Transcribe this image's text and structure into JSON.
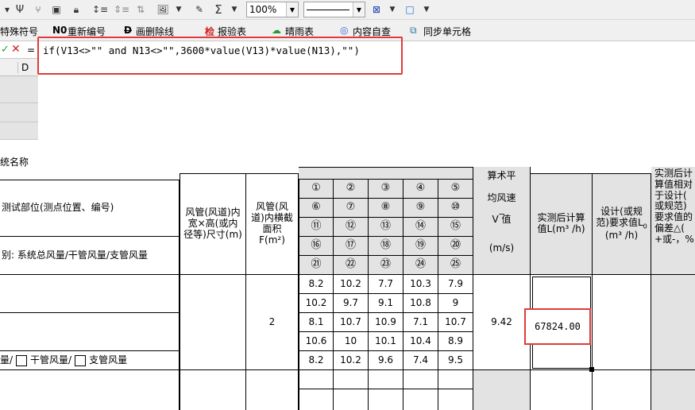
{
  "toolbar": {
    "zoom_value": "100%",
    "sigma": "Σ"
  },
  "toolbar2": {
    "special_symbol": "特殊符号",
    "renumber": "重新编号",
    "strike_line": "画删除线",
    "inspection_form": "报验表",
    "weather_form": "晴雨表",
    "content_check": "内容自查",
    "sync_cell": "同步单元格"
  },
  "formula": {
    "equals": "=",
    "text": "if(V13<>\"\" and N13<>\"\",3600*value(V13)*value(N13),\"\")"
  },
  "column_header": {
    "d": "D"
  },
  "sheet": {
    "system_name_label": "统名称",
    "measure_location": "测试部位(测点位置、编号)",
    "duct_size": "风管(风道)内宽×高(或内径等)尺寸(m)",
    "duct_area": "风管(风道)内横截面积F(m²)",
    "avg_speed_top": "算术平",
    "avg_speed": "均风速",
    "avg_speed_dash": "_",
    "v_value": "V 值",
    "speed_unit": "(m/s)",
    "measured_volume": "实测后计算值L(m³ /h)",
    "design_volume_a": "设计(或规范)要求值L",
    "design_volume_sub": "0",
    "design_volume_b": "(m³ /h)",
    "dev_line1": "实测后计",
    "dev_line2": "算值相对",
    "dev_line3": "于设计(",
    "dev_line4": "或规范)",
    "dev_line5": "要求值的",
    "dev_line6": "偏差△(",
    "dev_line7": "+或-，%)",
    "category_label": "别: 系统总风量/干管风量/支管风量",
    "circles": [
      "①",
      "②",
      "③",
      "④",
      "⑤",
      "⑥",
      "⑦",
      "⑧",
      "⑨",
      "⑩",
      "⑪",
      "⑫",
      "⑬",
      "⑭",
      "⑮",
      "⑯",
      "⑰",
      "⑱",
      "⑲",
      "⑳",
      "㉑",
      "㉒",
      "㉓",
      "㉔",
      "㉕"
    ],
    "readings": [
      [
        "8.2",
        "10.2",
        "7.7",
        "10.3",
        "7.9"
      ],
      [
        "10.2",
        "9.7",
        "9.1",
        "10.8",
        "9"
      ],
      [
        "8.1",
        "10.7",
        "10.9",
        "7.1",
        "10.7"
      ],
      [
        "10.6",
        "10",
        "10.1",
        "10.4",
        "8.9"
      ],
      [
        "8.2",
        "10.2",
        "9.6",
        "7.4",
        "9.5"
      ]
    ],
    "area_value": "2",
    "avg_value": "9.42",
    "measured_value": "67824.00",
    "checkbox_main_tail": "量/",
    "checkbox_trunk": "干管风量/",
    "checkbox_branch": "支管风量"
  },
  "colors": {
    "highlight": "#e03a3a",
    "grey": "#e3e3e3"
  }
}
